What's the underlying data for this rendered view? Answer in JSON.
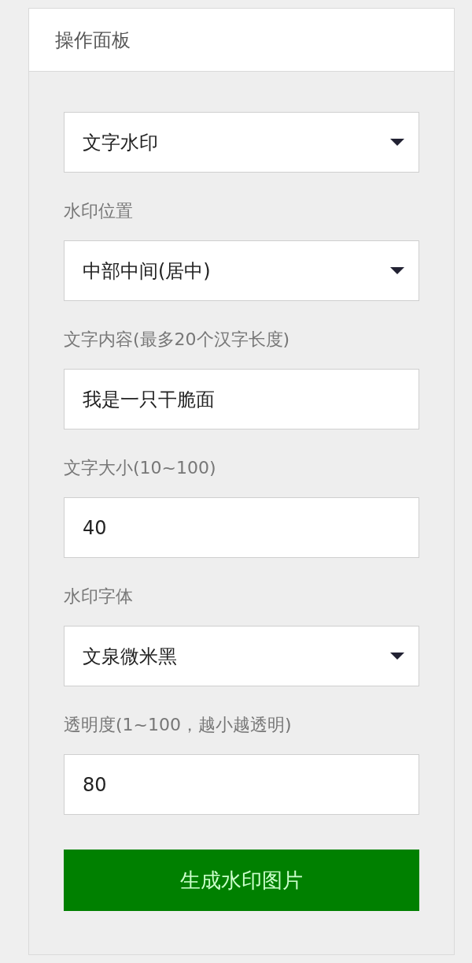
{
  "panel": {
    "title": "操作面板"
  },
  "fields": [
    {
      "kind": "select",
      "value": "文字水印"
    },
    {
      "kind": "select",
      "label": "水印位置",
      "value": "中部中间(居中)"
    },
    {
      "kind": "input",
      "label": "文字内容(最多20个汉字长度)",
      "value": "我是一只干脆面"
    },
    {
      "kind": "input",
      "label": "文字大小(10~100)",
      "value": "40"
    },
    {
      "kind": "select",
      "label": "水印字体",
      "value": "文泉微米黑"
    },
    {
      "kind": "input",
      "label": "透明度(1~100，越小越透明)",
      "value": "80"
    }
  ],
  "button": {
    "label": "生成水印图片"
  }
}
